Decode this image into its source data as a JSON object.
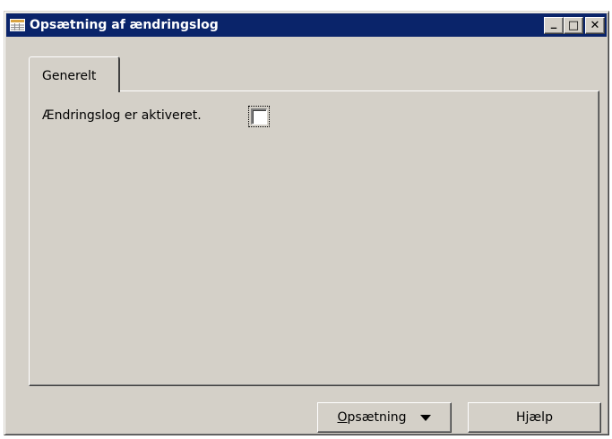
{
  "window": {
    "title": "Opsætning af ændringslog",
    "icon": "form-icon",
    "controls": {
      "minimize": "_",
      "maximize": "□",
      "close": "✕"
    }
  },
  "tabs": [
    {
      "label": "Generelt",
      "active": true
    }
  ],
  "form": {
    "change_log_label": "Ændringslog er aktiveret.",
    "change_log_checked": false
  },
  "buttons": {
    "setup_first": "O",
    "setup_rest": "psætning",
    "help": "Hjælp"
  },
  "colors": {
    "titlebar": "#0a246a",
    "face": "#d4d0c8"
  }
}
